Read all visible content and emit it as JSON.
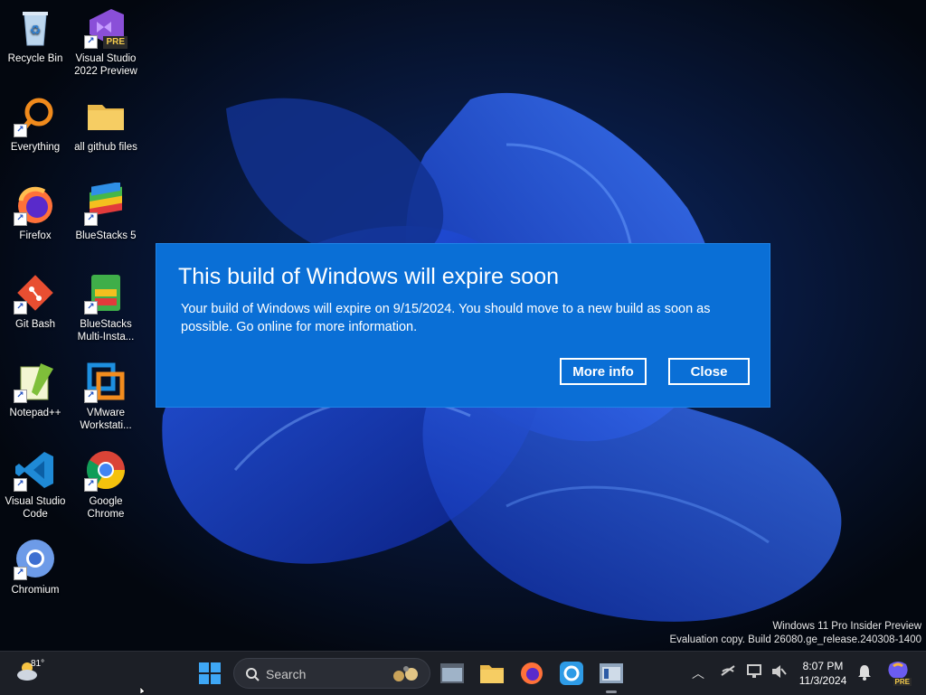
{
  "desktop": {
    "icons": [
      {
        "label": "Recycle Bin"
      },
      {
        "label": "Visual Studio 2022 Preview",
        "badge": "PRE"
      },
      {
        "label": "Everything"
      },
      {
        "label": "all github files"
      },
      {
        "label": "Firefox"
      },
      {
        "label": "BlueStacks 5"
      },
      {
        "label": "Git Bash"
      },
      {
        "label": "BlueStacks Multi-Insta..."
      },
      {
        "label": "Notepad++"
      },
      {
        "label": "VMware Workstati..."
      },
      {
        "label": "Visual Studio Code"
      },
      {
        "label": "Google Chrome"
      },
      {
        "label": "Chromium"
      }
    ]
  },
  "dialog": {
    "title": "This build of Windows will expire soon",
    "message": "Your build of Windows will expire on 9/15/2024. You should move to a new build as soon as possible. Go online for more information.",
    "more_info_label": "More info",
    "close_label": "Close",
    "background_color": "#0a6fd6"
  },
  "watermark": {
    "line1": "Windows 11 Pro Insider Preview",
    "line2": "Evaluation copy. Build 26080.ge_release.240308-1400"
  },
  "taskbar": {
    "weather_temp": "81°",
    "search_placeholder": "Search",
    "apps": [
      "start-icon",
      "file-explorer-window-icon",
      "folder-icon",
      "firefox-icon",
      "sync-app-icon",
      "window-app-icon"
    ],
    "clock_time": "8:07 PM",
    "clock_date": "11/3/2024",
    "tray_badge": "PRE"
  }
}
